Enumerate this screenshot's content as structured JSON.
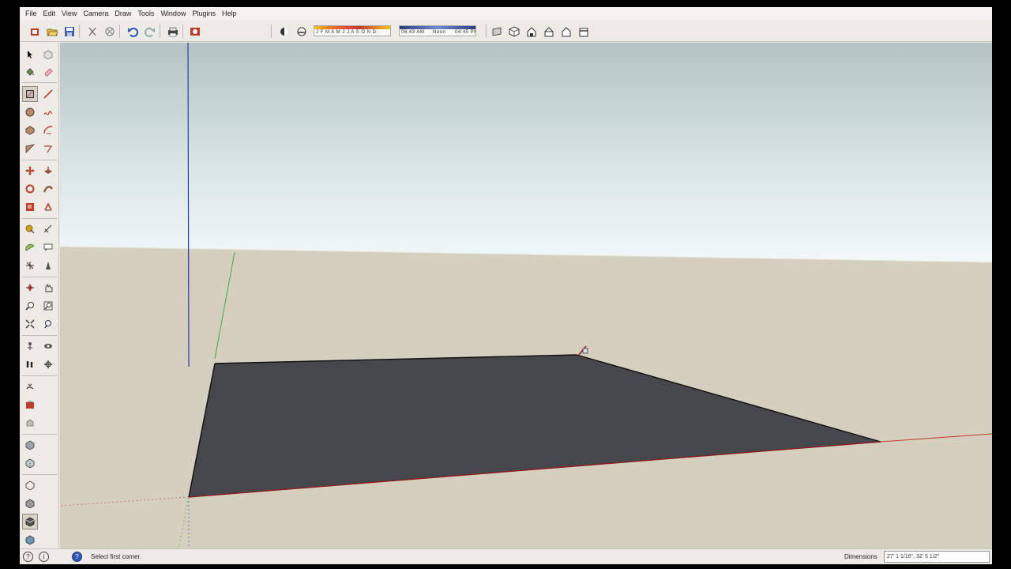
{
  "menu": [
    "File",
    "Edit",
    "View",
    "Camera",
    "Draw",
    "Tools",
    "Window",
    "Plugins",
    "Help"
  ],
  "icons": {
    "top_toolbar": [
      "get-models-icon",
      "open-icon",
      "save-icon",
      "cut-icon",
      "erase-icon",
      "undo-icon",
      "redo-icon",
      "print-icon",
      "model-info-icon",
      "shadow-settings-icon",
      "fog-icon",
      "section-plane-icon",
      "iso-view-icon",
      "top-view-icon",
      "front-view-icon",
      "right-view-icon",
      "back-view-icon"
    ],
    "left_toolbar": [
      "select-icon",
      "make-component-icon",
      "paint-bucket-icon",
      "eraser-icon",
      "rectangle-icon",
      "line-icon",
      "circle-icon",
      "freehand-icon",
      "polygon-icon",
      "arc-icon",
      "pie-icon",
      "arc-3pt-icon",
      "move-icon",
      "push-pull-icon",
      "rotate-icon",
      "follow-me-icon",
      "scale-icon",
      "offset-icon",
      "tape-measure-icon",
      "dimension-icon",
      "protractor-icon",
      "text-icon",
      "axes-icon",
      "3d-text-icon",
      "orbit-icon",
      "pan-icon",
      "zoom-icon",
      "zoom-window-icon",
      "zoom-extents-icon",
      "zoom-previous-icon",
      "position-camera-icon",
      "look-around-icon",
      "walk-icon",
      "section-plane-tool-icon",
      "sandbox-icon",
      "warehouse-icon",
      "extension-icon",
      "xray-icon",
      "back-edges-icon",
      "wireframe-icon",
      "hidden-line-icon",
      "shaded-icon",
      "shaded-textures-icon",
      "monochrome-icon"
    ],
    "status": [
      "geo-location-icon",
      "credits-icon",
      "help-icon"
    ]
  },
  "toolbar": {
    "shadow_strip_text": "J F M A M J J A S O N D",
    "time_strip_left": "06:43 AM",
    "time_strip_mid": "Noon",
    "time_strip_right": "04:45 PM"
  },
  "status": {
    "message": "Select first corner.",
    "dimensions_label": "Dimensions",
    "dimensions_value": "27' 1 1/16\", 32' 5 1/2\""
  },
  "colors": {
    "sky_top": "#b4c3c3",
    "sky_horizon": "#f2f8f9",
    "ground": "#d4cfbf",
    "face": "#46474c",
    "axis_red": "#c0392b",
    "axis_green": "#3cb043",
    "axis_blue": "#2a3fa8"
  }
}
